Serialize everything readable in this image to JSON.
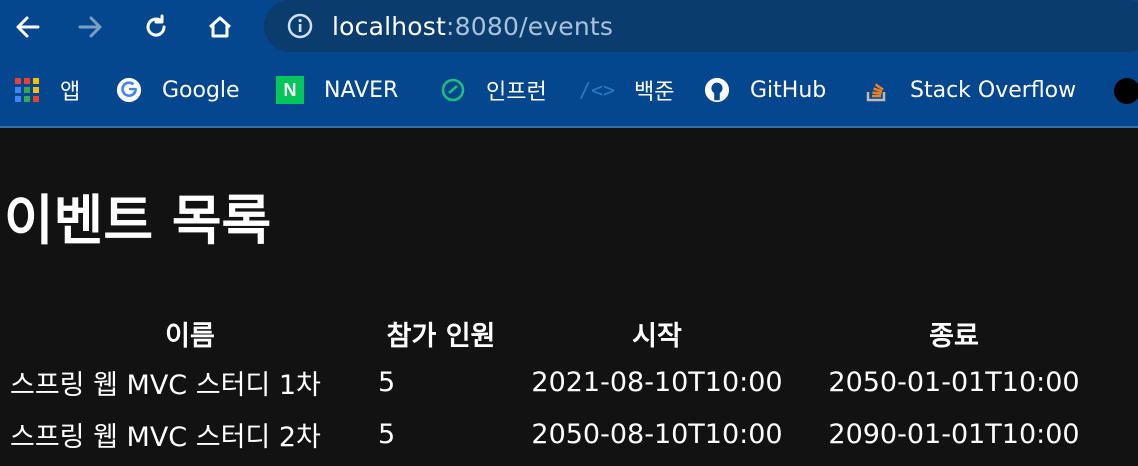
{
  "browser": {
    "url_host": "localhost",
    "url_rest": ":8080/events",
    "icons": [
      "back-arrow-icon",
      "forward-arrow-icon",
      "reload-icon",
      "home-icon",
      "info-icon"
    ]
  },
  "bookmarks": [
    {
      "label": "앱",
      "icon": "apps-grid-icon"
    },
    {
      "label": "Google",
      "icon": "google-icon"
    },
    {
      "label": "NAVER",
      "icon": "naver-icon"
    },
    {
      "label": "인프런",
      "icon": "inflearn-icon"
    },
    {
      "label": "백준",
      "icon": "baekjoon-icon"
    },
    {
      "label": "GitHub",
      "icon": "github-icon"
    },
    {
      "label": "Stack Overflow",
      "icon": "stackoverflow-icon"
    }
  ],
  "page": {
    "title": "이벤트 목록",
    "columns": [
      "이름",
      "참가 인원",
      "시작",
      "종료"
    ],
    "rows": [
      [
        "스프링 웹 MVC 스터디 1차",
        "5",
        "2021-08-10T10:00",
        "2050-01-01T10:00"
      ],
      [
        "스프링 웹 MVC 스터디 2차",
        "5",
        "2050-08-10T10:00",
        "2090-01-01T10:00"
      ]
    ]
  }
}
